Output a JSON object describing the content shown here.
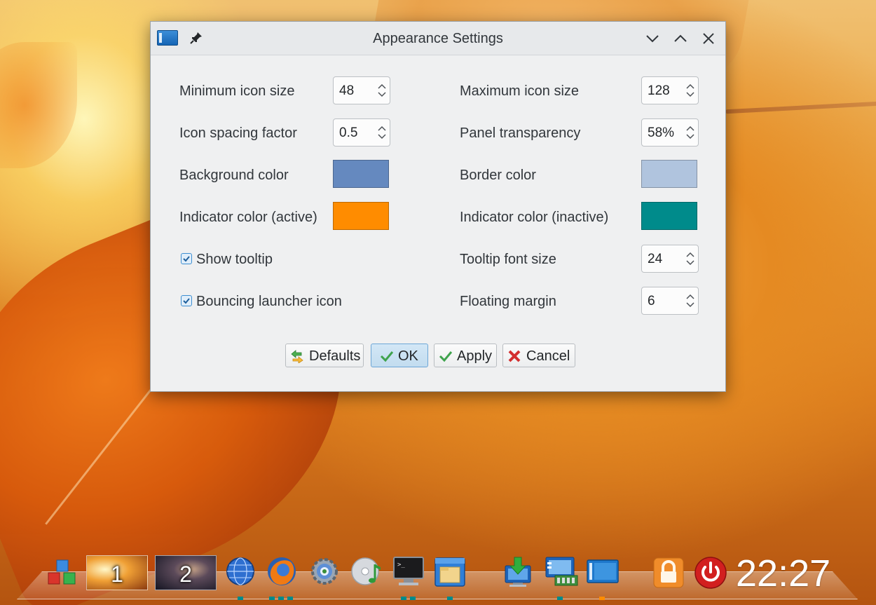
{
  "window": {
    "title": "Appearance Settings"
  },
  "settings": {
    "min_icon_size": {
      "label": "Minimum icon size",
      "value": "48"
    },
    "max_icon_size": {
      "label": "Maximum icon size",
      "value": "128"
    },
    "icon_spacing": {
      "label": "Icon spacing factor",
      "value": "0.5"
    },
    "panel_transparency": {
      "label": "Panel transparency",
      "value": "58%"
    },
    "background_color": {
      "label": "Background color",
      "color": "#6589bf"
    },
    "border_color": {
      "label": "Border color",
      "color": "#b0c4de"
    },
    "indicator_active": {
      "label": "Indicator color (active)",
      "color": "#ff8c00"
    },
    "indicator_inactive": {
      "label": "Indicator color (inactive)",
      "color": "#008b8b"
    },
    "show_tooltip": {
      "label": "Show tooltip",
      "checked": true
    },
    "tooltip_font_size": {
      "label": "Tooltip font size",
      "value": "24"
    },
    "bouncing_icon": {
      "label": "Bouncing launcher icon",
      "checked": true
    },
    "floating_margin": {
      "label": "Floating margin",
      "value": "6"
    }
  },
  "buttons": {
    "defaults": "Defaults",
    "ok": "OK",
    "apply": "Apply",
    "cancel": "Cancel"
  },
  "taskbar": {
    "desktops": [
      {
        "number": "1"
      },
      {
        "number": "2"
      }
    ],
    "launchers": [
      "cube-icon",
      "globe-icon",
      "firefox-icon",
      "settings-gear-icon",
      "media-disc-icon",
      "terminal-icon",
      "file-manager-icon",
      "download-icon",
      "network-monitor-icon",
      "window-app-icon",
      "lock-icon",
      "power-icon"
    ],
    "clock": "22:27",
    "indicator_colors": {
      "active": "#ff8c00",
      "inactive": "#008b8b"
    }
  }
}
